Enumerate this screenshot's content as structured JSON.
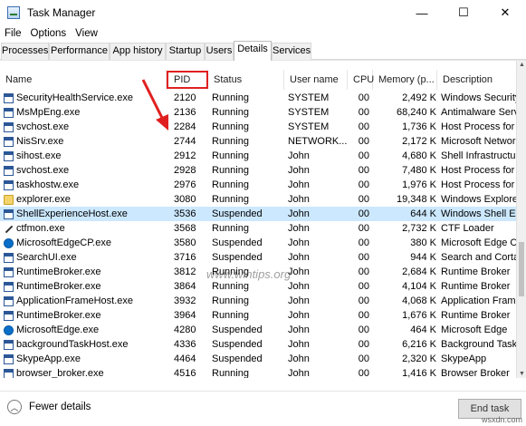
{
  "window": {
    "title": "Task Manager",
    "minimize": "—",
    "maximize": "☐",
    "close": "✕"
  },
  "menu": [
    "File",
    "Options",
    "View"
  ],
  "tabs": [
    "Processes",
    "Performance",
    "App history",
    "Startup",
    "Users",
    "Details",
    "Services"
  ],
  "active_tab": "Details",
  "columns": [
    "Name",
    "PID",
    "Status",
    "User name",
    "CPU",
    "Memory (p...",
    "Description"
  ],
  "rows": [
    {
      "name": "SecurityHealthService.exe",
      "pid": "2120",
      "status": "Running",
      "user": "SYSTEM",
      "cpu": "00",
      "mem": "2,492 K",
      "desc": "Windows Security H",
      "icon": "generic"
    },
    {
      "name": "MsMpEng.exe",
      "pid": "2136",
      "status": "Running",
      "user": "SYSTEM",
      "cpu": "00",
      "mem": "68,240 K",
      "desc": "Antimalware Service",
      "icon": "generic"
    },
    {
      "name": "svchost.exe",
      "pid": "2284",
      "status": "Running",
      "user": "SYSTEM",
      "cpu": "00",
      "mem": "1,736 K",
      "desc": "Host Process for W",
      "icon": "generic"
    },
    {
      "name": "NisSrv.exe",
      "pid": "2744",
      "status": "Running",
      "user": "NETWORK...",
      "cpu": "00",
      "mem": "2,172 K",
      "desc": "Microsoft Network",
      "icon": "generic"
    },
    {
      "name": "sihost.exe",
      "pid": "2912",
      "status": "Running",
      "user": "John",
      "cpu": "00",
      "mem": "4,680 K",
      "desc": "Shell Infrastructure",
      "icon": "generic"
    },
    {
      "name": "svchost.exe",
      "pid": "2928",
      "status": "Running",
      "user": "John",
      "cpu": "00",
      "mem": "7,480 K",
      "desc": "Host Process for W",
      "icon": "generic"
    },
    {
      "name": "taskhostw.exe",
      "pid": "2976",
      "status": "Running",
      "user": "John",
      "cpu": "00",
      "mem": "1,976 K",
      "desc": "Host Process for W",
      "icon": "generic"
    },
    {
      "name": "explorer.exe",
      "pid": "3080",
      "status": "Running",
      "user": "John",
      "cpu": "00",
      "mem": "19,348 K",
      "desc": "Windows Explorer",
      "icon": "folder"
    },
    {
      "name": "ShellExperienceHost.exe",
      "pid": "3536",
      "status": "Suspended",
      "user": "John",
      "cpu": "00",
      "mem": "644 K",
      "desc": "Windows Shell Exp",
      "icon": "generic",
      "selected": true
    },
    {
      "name": "ctfmon.exe",
      "pid": "3568",
      "status": "Running",
      "user": "John",
      "cpu": "00",
      "mem": "2,732 K",
      "desc": "CTF Loader",
      "icon": "ctf"
    },
    {
      "name": "MicrosoftEdgeCP.exe",
      "pid": "3580",
      "status": "Suspended",
      "user": "John",
      "cpu": "00",
      "mem": "380 K",
      "desc": "Microsoft Edge Co",
      "icon": "edge"
    },
    {
      "name": "SearchUI.exe",
      "pid": "3716",
      "status": "Suspended",
      "user": "John",
      "cpu": "00",
      "mem": "944 K",
      "desc": "Search and Cortana",
      "icon": "generic"
    },
    {
      "name": "RuntimeBroker.exe",
      "pid": "3812",
      "status": "Running",
      "user": "John",
      "cpu": "00",
      "mem": "2,684 K",
      "desc": "Runtime Broker",
      "icon": "generic"
    },
    {
      "name": "RuntimeBroker.exe",
      "pid": "3864",
      "status": "Running",
      "user": "John",
      "cpu": "00",
      "mem": "4,104 K",
      "desc": "Runtime Broker",
      "icon": "generic"
    },
    {
      "name": "ApplicationFrameHost.exe",
      "pid": "3932",
      "status": "Running",
      "user": "John",
      "cpu": "00",
      "mem": "4,068 K",
      "desc": "Application Frame",
      "icon": "generic"
    },
    {
      "name": "RuntimeBroker.exe",
      "pid": "3964",
      "status": "Running",
      "user": "John",
      "cpu": "00",
      "mem": "1,676 K",
      "desc": "Runtime Broker",
      "icon": "generic"
    },
    {
      "name": "MicrosoftEdge.exe",
      "pid": "4280",
      "status": "Suspended",
      "user": "John",
      "cpu": "00",
      "mem": "464 K",
      "desc": "Microsoft Edge",
      "icon": "edge"
    },
    {
      "name": "backgroundTaskHost.exe",
      "pid": "4336",
      "status": "Suspended",
      "user": "John",
      "cpu": "00",
      "mem": "6,216 K",
      "desc": "Background Task H",
      "icon": "generic"
    },
    {
      "name": "SkypeApp.exe",
      "pid": "4464",
      "status": "Suspended",
      "user": "John",
      "cpu": "00",
      "mem": "2,320 K",
      "desc": "SkypeApp",
      "icon": "generic"
    },
    {
      "name": "browser_broker.exe",
      "pid": "4516",
      "status": "Running",
      "user": "John",
      "cpu": "00",
      "mem": "1,416 K",
      "desc": "Browser Broker",
      "icon": "generic"
    }
  ],
  "watermark": "www.wintips.org",
  "footer": {
    "fewer_details": "Fewer details",
    "end_task": "End task"
  },
  "site_mark": "wsxdn.com",
  "colors": {
    "selected_row": "#cce8ff",
    "highlight_box": "#e02020",
    "arrow": "#e02020"
  }
}
